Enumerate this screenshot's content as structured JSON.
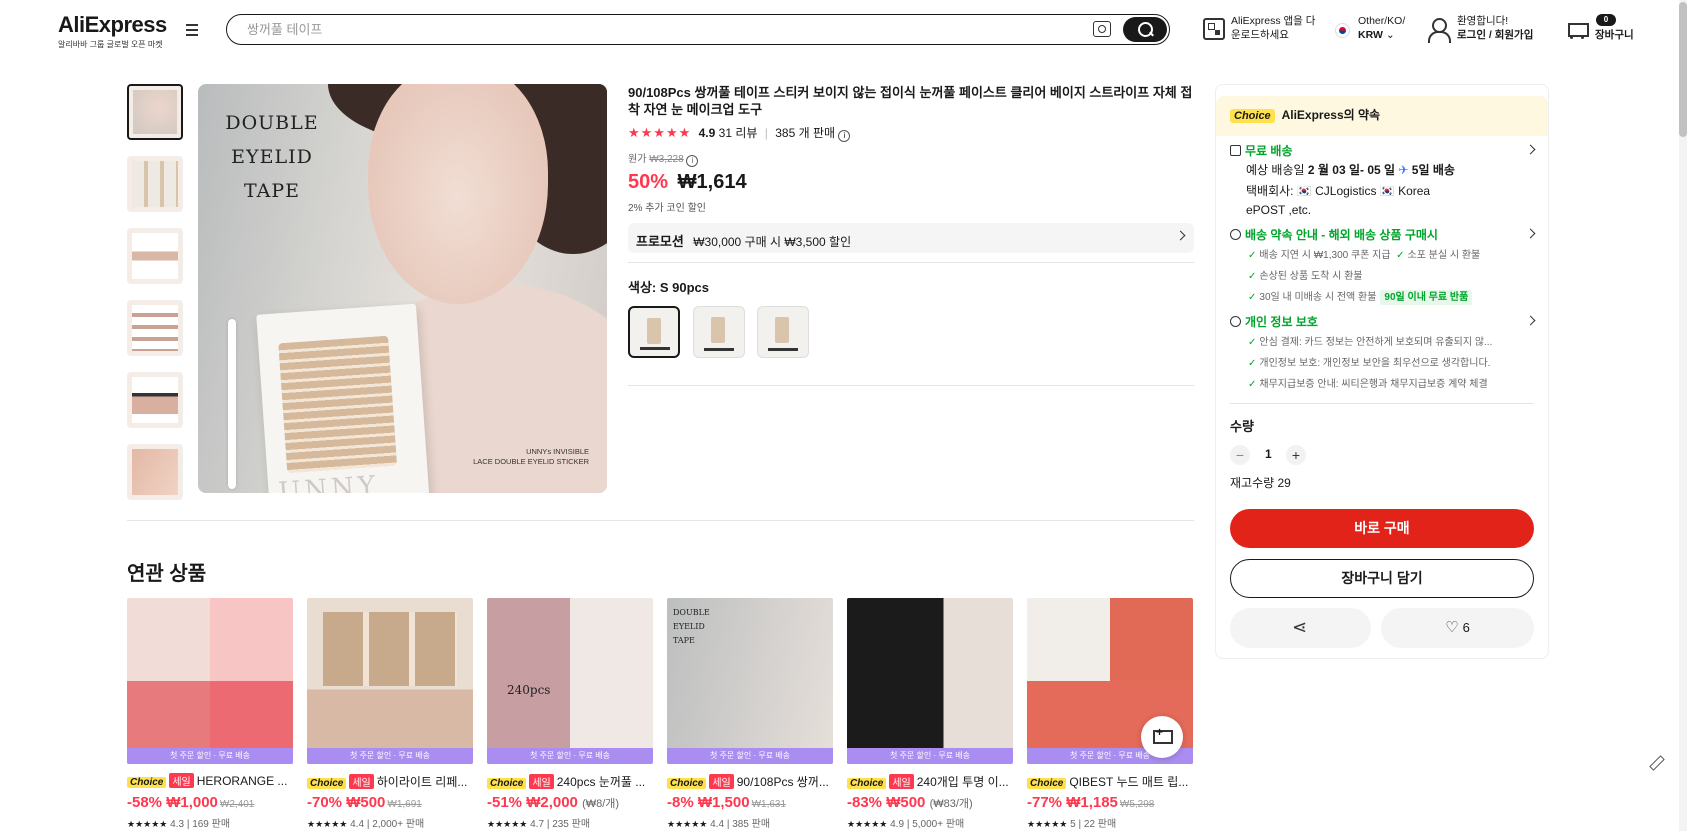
{
  "header": {
    "logo": "AliExpress",
    "logo_sub": "알리바바 그룹 글로벌 오픈 마켓",
    "search_placeholder": "쌍꺼풀 테이프",
    "app_line1": "AliExpress 앱을 다",
    "app_line2": "운로드하세요",
    "region_line1": "Other/KO/",
    "region_line2": "KRW",
    "user_line1": "환영합니다!",
    "user_line2": "로그인 / 회원가입",
    "cart_count": "0",
    "cart_label": "장바구니"
  },
  "gallery": {
    "image_title_lines": [
      "DOUBLE",
      "EYELID",
      "TAPE"
    ],
    "caption_line1": "UNNYs INVISIBLE",
    "caption_line2": "LACE DOUBLE EYELID STICKER",
    "brand": "UNNY",
    "thumb_count": 6
  },
  "product": {
    "title": "90/108Pcs 쌍꺼풀 테이프 스티커 보이지 않는 접이식 눈꺼풀 페이스트 클리어 베이지 스트라이프 자체 접착 자연 눈 메이크업 도구",
    "stars": "★★★★★",
    "rating": "4.9",
    "reviews": "31 리뷰",
    "sold": "385 개 판매",
    "original_label": "원가",
    "original_price": "₩3,228",
    "discount": "50%",
    "price": "₩1,614",
    "coin_note": "2% 추가 코인 할인",
    "promo_label": "프로모션",
    "promo_text": "₩30,000 구매 시 ₩3,500 할인",
    "color_label": "색상: S 90pcs"
  },
  "sidebar": {
    "choice_badge": "Choice",
    "promise": "AliExpress의 약속",
    "shipping_title": "무료 배송",
    "delivery_pre": "예상 배송일",
    "delivery_dates": "2 월 03 일- 05 일",
    "delivery_days": "5일 배송",
    "carrier_line1": "택배회사: 🇰🇷 CJLogistics 🇰🇷 Korea",
    "carrier_line2": "ePOST ,etc.",
    "guarantee_title": "배송 약속 안내 - 해외 배송 상품 구매시",
    "guarantee_1a": "배송 지연 시 ₩1,300 쿠폰 지급",
    "guarantee_1b": "소포 분실 시 환불",
    "guarantee_2": "손상된 상품 도착 시 환불",
    "guarantee_3": "30일 내 미배송 시 전액 환불",
    "guarantee_3_pill": "90일 이내 무료 반품",
    "privacy_title": "개인 정보 보호",
    "privacy_1": "안심 결제: 카드 정보는 안전하게 보호되며 유출되지 않...",
    "privacy_2": "개인정보 보호: 개인정보 보안을 최우선으로 생각합니다.",
    "privacy_3": "채무지급보증 안내: 씨티은행과 채무지급보증 계약 체결",
    "qty_label": "수량",
    "qty_minus": "−",
    "qty_value": "1",
    "qty_plus": "+",
    "stock": "재고수량 29",
    "buy_now": "바로 구매",
    "add_to_cart": "장바구니 담기",
    "wish_count": "6"
  },
  "related": {
    "title": "연관 상품",
    "band": "첫 주문 할인 · 무료 배송",
    "items": [
      {
        "badge": "Choice",
        "sale": "세일",
        "name": "HERORANGE ...",
        "discount": "-58%",
        "price": "₩1,000",
        "orig": "₩2,401",
        "unit": "",
        "stars": "★★★★★",
        "rate": "4.3",
        "sold": "| 169 판매"
      },
      {
        "badge": "Choice",
        "sale": "세일",
        "name": "하이라이트 리페...",
        "discount": "-70%",
        "price": "₩500",
        "orig": "₩1,691",
        "unit": "",
        "stars": "★★★★★",
        "rate": "4.4",
        "sold": "| 2,000+ 판매"
      },
      {
        "badge": "Choice",
        "sale": "세일",
        "name": "240pcs 눈꺼풀 ...",
        "discount": "-51%",
        "price": "₩2,000",
        "orig": "",
        "unit": "(₩8/개)",
        "stars": "★★★★★",
        "rate": "4.7",
        "sold": "| 235 판매"
      },
      {
        "badge": "Choice",
        "sale": "세일",
        "name": "90/108Pcs 쌍꺼...",
        "discount": "-8%",
        "price": "₩1,500",
        "orig": "₩1,631",
        "unit": "",
        "stars": "★★★★★",
        "rate": "4.4",
        "sold": "| 385 판매"
      },
      {
        "badge": "Choice",
        "sale": "세일",
        "name": "240개입 투명 이...",
        "discount": "-83%",
        "price": "₩500",
        "orig": "",
        "unit": "(₩83/개)",
        "stars": "★★★★★",
        "rate": "4.9",
        "sold": "| 5,000+ 판매"
      },
      {
        "badge": "Choice",
        "sale": "",
        "name": "QIBEST 누드 매트 립...",
        "discount": "-77%",
        "price": "₩1,185",
        "orig": "₩5,298",
        "unit": "",
        "stars": "★★★★★",
        "rate": "5",
        "sold": "| 22 판매"
      }
    ]
  },
  "colors": {
    "accent_red": "#fd384f",
    "buy_red": "#e2231a",
    "choice_yellow": "#ffe14b",
    "green": "#00a52b",
    "band_purple": "#a98df0"
  }
}
